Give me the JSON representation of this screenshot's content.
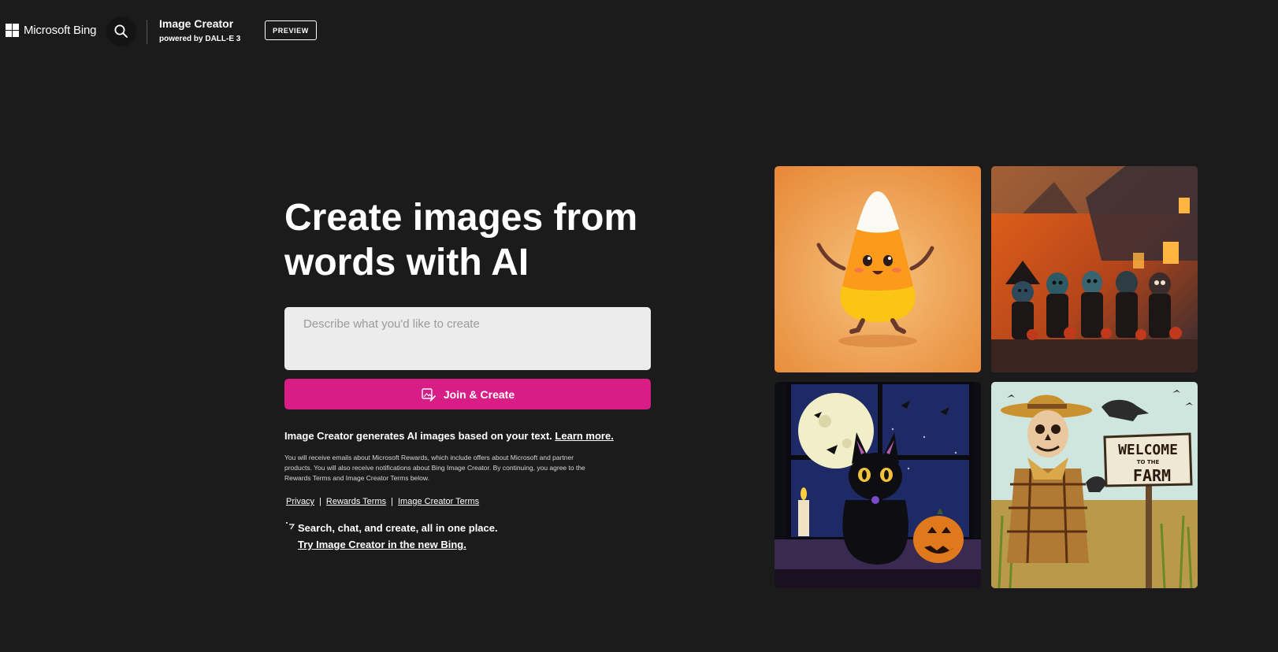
{
  "header": {
    "brand_name": "Microsoft Bing",
    "app_title": "Image Creator",
    "app_subtitle": "powered by DALL-E 3",
    "preview_label": "PREVIEW",
    "search_icon": "search-icon",
    "logo_icon": "microsoft-logo-icon"
  },
  "hero": {
    "title": "Create images from words with AI",
    "prompt_placeholder": "Describe what you'd like to create",
    "prompt_value": "",
    "join_button_label": "Join & Create",
    "join_button_icon": "create-image-icon",
    "info_text": "Image Creator generates AI images based on your text.",
    "learn_more_label": "Learn more.",
    "disclaimer": "You will receive emails about Microsoft Rewards, which include offers about Microsoft and partner products. You will also receive notifications about Bing Image Creator. By continuing, you agree to the Rewards Terms and Image Creator Terms below.",
    "links": [
      {
        "label": "Privacy"
      },
      {
        "label": "Rewards Terms"
      },
      {
        "label": "Image Creator Terms"
      }
    ],
    "link_separator": "|",
    "try_text": "Search, chat, and create, all in one place.",
    "try_link": "Try Image Creator in the new Bing.",
    "try_icon": "sparkle-icon"
  },
  "gallery": {
    "images": [
      {
        "subject": "candy-corn-character"
      },
      {
        "subject": "halloween-zombie-kids"
      },
      {
        "subject": "black-cat-pumpkin-moon"
      },
      {
        "subject": "scarecrow-welcome-sign"
      }
    ],
    "sign_line1": "WELCOME",
    "sign_line2": "TO THE",
    "sign_line3": "FARM"
  },
  "colors": {
    "background": "#1c1b1c",
    "accent": "#d81d86",
    "input_bg": "#ececec"
  }
}
